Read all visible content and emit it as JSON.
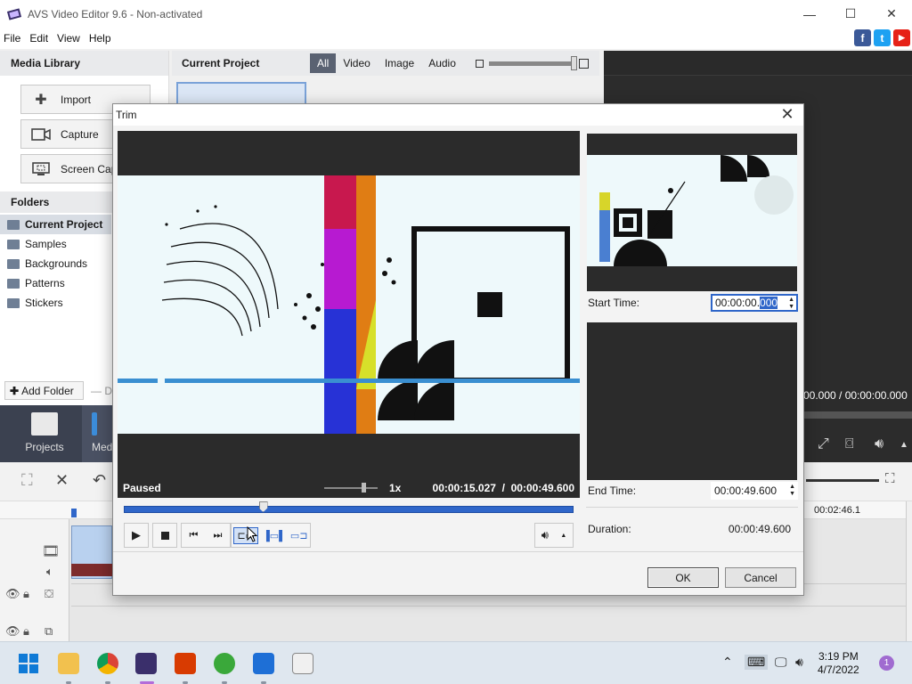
{
  "window": {
    "title": "AVS Video Editor 9.6 - Non-activated",
    "minimize": "—",
    "maximize": "☐",
    "close": "✕"
  },
  "menu": [
    "File",
    "Edit",
    "View",
    "Help"
  ],
  "social": {
    "facebook": "f",
    "twitter": "t",
    "youtube": "▶"
  },
  "media_library": {
    "title": "Media Library",
    "import": "Import",
    "capture": "Capture",
    "screen_capture": "Screen Cap"
  },
  "folders": {
    "title": "Folders",
    "items": [
      "Current Project",
      "Samples",
      "Backgrounds",
      "Patterns",
      "Stickers"
    ],
    "add_folder": "Add Folder",
    "delete_partial": "D"
  },
  "project": {
    "title": "Current Project",
    "tabs": [
      "All",
      "Video",
      "Image",
      "Audio"
    ],
    "active_tab": "All"
  },
  "preview": {
    "time": "00.000 / 00:00:00.000"
  },
  "bottom_tabs": [
    "Projects",
    "Medi"
  ],
  "timeline": {
    "ruler_time": "00:02:46.1"
  },
  "trim": {
    "title": "Trim",
    "close": "✕",
    "status": "Paused",
    "speed": "1x",
    "current_time": "00:00:15.027",
    "separator": "/",
    "total_time": "00:00:49.600",
    "scrub_position": 0.31,
    "start_time_label": "Start Time:",
    "start_time_prefix": "00:00:00.",
    "start_time_selected": "000",
    "end_time_label": "End Time:",
    "end_time": "00:00:49.600",
    "duration_label": "Duration:",
    "duration": "00:00:49.600",
    "ok": "OK",
    "cancel": "Cancel"
  },
  "taskbar": {
    "time": "3:19 PM",
    "date": "4/7/2022",
    "notifications": "1"
  },
  "colors": {
    "accent": "#2f66c9",
    "tab_bar": "#3b4150",
    "preview_bg": "#2c2c2c"
  }
}
